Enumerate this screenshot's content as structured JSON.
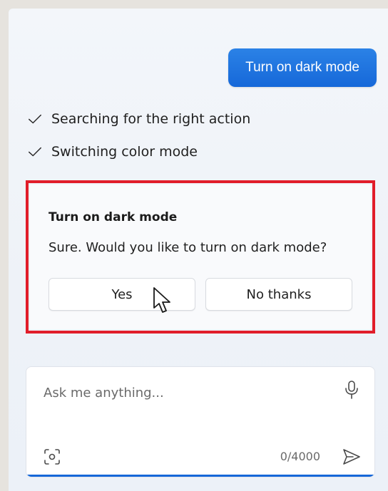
{
  "chat": {
    "user_message": "Turn on dark mode",
    "steps": [
      {
        "label": "Searching for the right action"
      },
      {
        "label": "Switching color mode"
      }
    ]
  },
  "card": {
    "title": "Turn on dark mode",
    "text": "Sure. Would you like to turn on dark mode?",
    "yes_label": "Yes",
    "no_label": "No thanks"
  },
  "composer": {
    "placeholder": "Ask me anything...",
    "counter": "0/4000"
  },
  "colors": {
    "accent": "#1668d9",
    "highlight": "#e11d2a"
  }
}
